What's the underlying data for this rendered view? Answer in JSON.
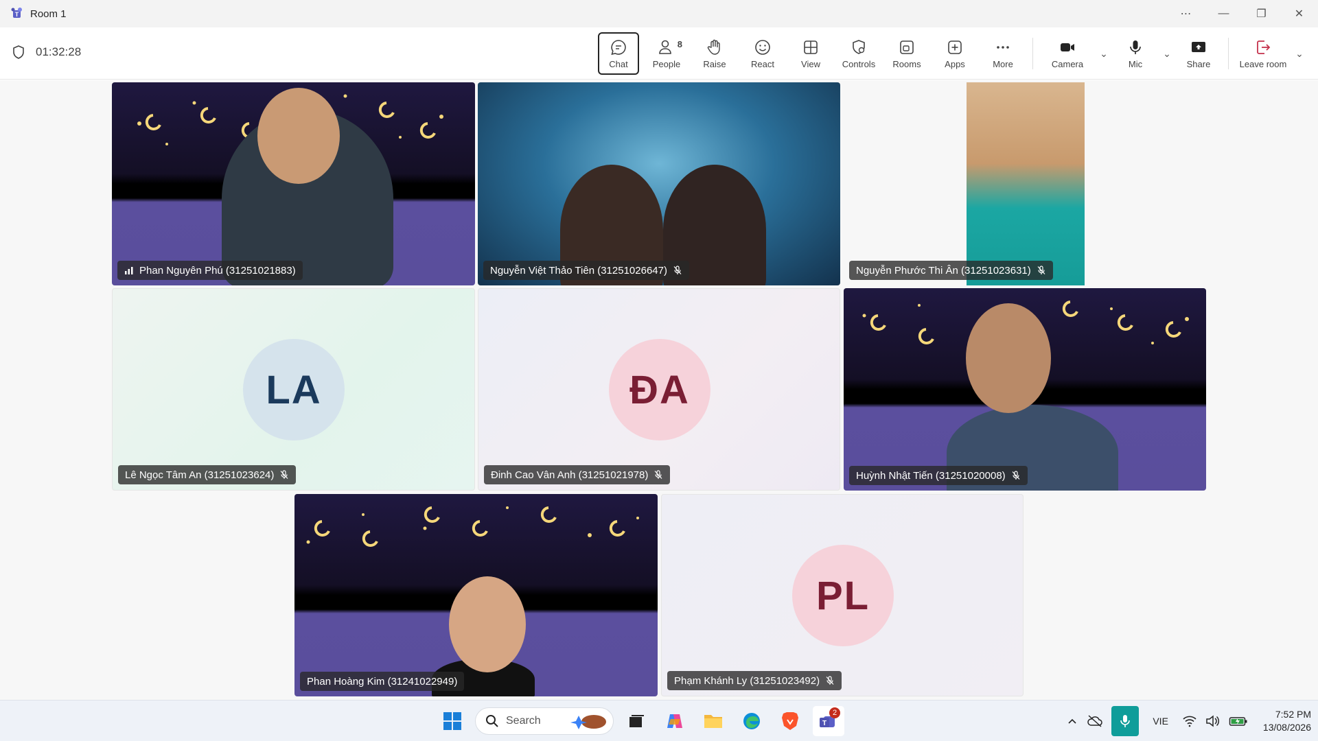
{
  "window": {
    "title": "Room 1"
  },
  "toolbar": {
    "timer": "01:32:28",
    "chat": "Chat",
    "people": "People",
    "people_count": "8",
    "raise": "Raise",
    "react": "React",
    "view": "View",
    "controls": "Controls",
    "rooms": "Rooms",
    "apps": "Apps",
    "more": "More",
    "camera": "Camera",
    "mic": "Mic",
    "share": "Share",
    "leave": "Leave room"
  },
  "participants": [
    {
      "name": "Phan Nguyên Phú (31251021883)",
      "video": true,
      "muted": false
    },
    {
      "name": "Nguyễn Việt Thảo Tiên (31251026647)",
      "video": true,
      "muted": true
    },
    {
      "name": "Nguyễn Phước Thi Ân (31251023631)",
      "video": true,
      "muted": true
    },
    {
      "name": "Lê Ngọc Tâm An (31251023624)",
      "initials": "LA",
      "video": false,
      "muted": true
    },
    {
      "name": "Đinh Cao Vân Anh (31251021978)",
      "initials": "ĐA",
      "video": false,
      "muted": true
    },
    {
      "name": "Huỳnh Nhật Tiến (31251020008)",
      "video": true,
      "muted": true
    },
    {
      "name": "Phan Hoàng Kim (31241022949)",
      "video": true,
      "muted": false
    },
    {
      "name": "Phạm Khánh Ly (31251023492)",
      "initials": "PL",
      "video": false,
      "muted": true
    }
  ],
  "taskbar": {
    "search_label": "Search",
    "teams_badge": "2",
    "language": "VIE",
    "time": "7:52 PM",
    "date": "13/08/2026"
  },
  "colors": {
    "avatar_la_bg": "#d5e3ec",
    "avatar_la_fg": "#1b3a5c",
    "avatar_da_bg": "#f6d2da",
    "avatar_da_fg": "#7a1e34",
    "avatar_pl_bg": "#f6d2da",
    "avatar_pl_fg": "#7a1e34",
    "leave_icon": "#c4314b",
    "teams_purple": "#5b5fc7"
  }
}
